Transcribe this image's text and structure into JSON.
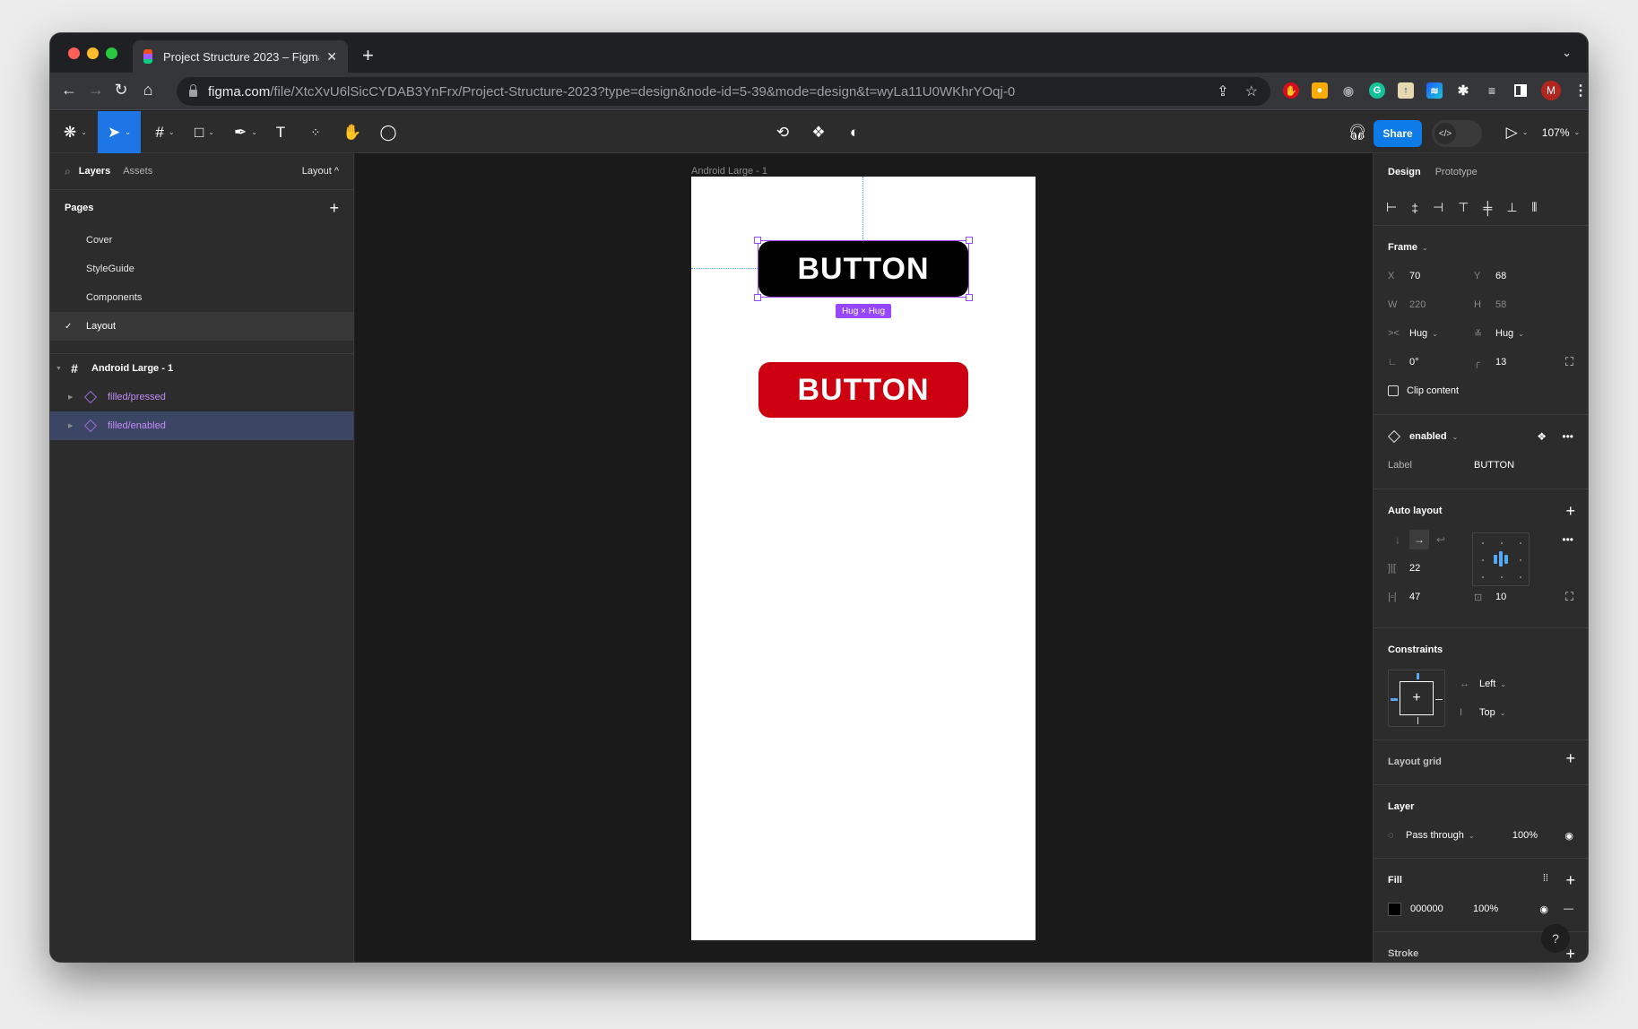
{
  "browser": {
    "tab_title": "Project Structure 2023 – Figma",
    "tab_close": "✕",
    "new_tab": "+",
    "url_domain": "figma.com",
    "url_path": "/file/XtcXvU6lSicCYDAB3YnFrx/Project-Structure-2023?type=design&node-id=5-39&mode=design&t=wyLa11U0WKhrYOqj-0",
    "profile_initial": "M",
    "colors": {
      "close": "#ff5f57",
      "minimize": "#febc2e",
      "maximize": "#28c840"
    }
  },
  "toolbar": {
    "share_label": "Share",
    "zoom_level": "107%",
    "dev_mode_icon": "</>",
    "accent": "#0d7ce8"
  },
  "left_panel": {
    "tabs": [
      "Layers",
      "Assets"
    ],
    "current_page_select": "Layout ^",
    "pages_title": "Pages",
    "pages": [
      {
        "label": "Cover",
        "current": false
      },
      {
        "label": "StyleGuide",
        "current": false
      },
      {
        "label": "Components",
        "current": false
      },
      {
        "label": "Layout",
        "current": true
      }
    ],
    "layers": {
      "frame": "Android Large - 1",
      "children": [
        {
          "label": "filled/pressed",
          "selected": false
        },
        {
          "label": "filled/enabled",
          "selected": true
        }
      ]
    }
  },
  "canvas": {
    "frame_label": "Android Large - 1",
    "button_primary_label": "BUTTON",
    "button_pressed_label": "BUTTON",
    "hug_badge": "Hug × Hug",
    "colors": {
      "primary": "#000000",
      "pressed": "#cc0010",
      "selection": "#9747ff"
    }
  },
  "right_panel": {
    "tabs": [
      "Design",
      "Prototype"
    ],
    "frame": {
      "title": "Frame",
      "x_label": "X",
      "x": "70",
      "y_label": "Y",
      "y": "68",
      "w_label": "W",
      "w": "220",
      "h_label": "H",
      "h": "58",
      "width_mode": "Hug",
      "height_mode": "Hug",
      "rotation": "0°",
      "corner_radius": "13",
      "clip_content": "Clip content"
    },
    "component": {
      "variant": "enabled",
      "prop_label": "Label",
      "prop_value": "BUTTON"
    },
    "auto_layout": {
      "title": "Auto layout",
      "gap": "22",
      "padding_h": "47",
      "padding_v": "10"
    },
    "constraints": {
      "title": "Constraints",
      "horizontal": "Left",
      "vertical": "Top"
    },
    "layout_grid": {
      "title": "Layout grid"
    },
    "layer": {
      "title": "Layer",
      "blend": "Pass through",
      "opacity": "100%"
    },
    "fill": {
      "title": "Fill",
      "hex": "000000",
      "opacity": "100%"
    },
    "stroke": {
      "title": "Stroke"
    },
    "help": "?"
  }
}
